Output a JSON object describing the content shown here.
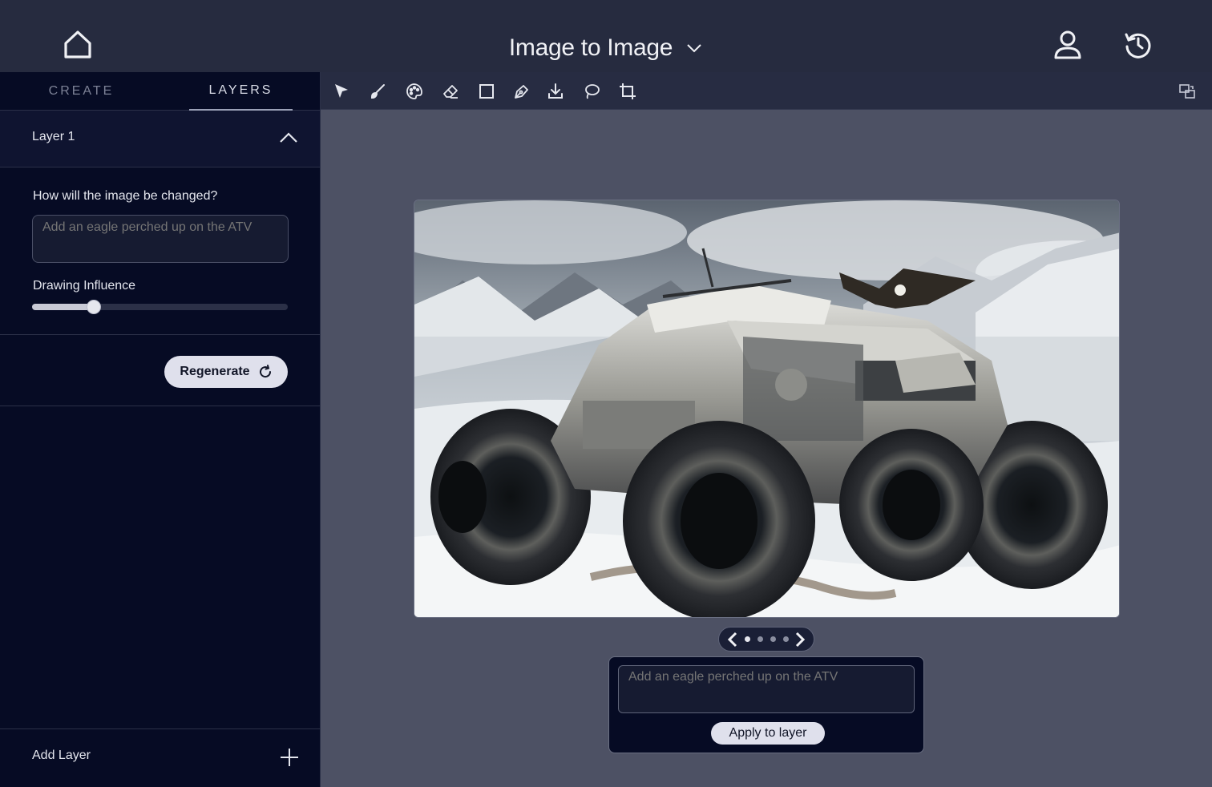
{
  "header": {
    "title": "Image to Image",
    "icons": {
      "home": "home-icon",
      "title_dropdown": "chevron-down-icon",
      "user": "user-icon",
      "history": "history-icon"
    }
  },
  "sidebar": {
    "tabs": [
      {
        "label": "CREATE",
        "active": false
      },
      {
        "label": "LAYERS",
        "active": true
      }
    ],
    "layer": {
      "name": "Layer 1",
      "expanded": true,
      "prompt_label": "How will the image be changed?",
      "prompt_placeholder": "Add an eagle perched up on the ATV",
      "influence_label": "Drawing Influence",
      "influence_value": 0.24,
      "regenerate_label": "Regenerate"
    },
    "add_layer_label": "Add Layer"
  },
  "toolbar": {
    "tools": [
      "select-tool-icon",
      "brush-tool-icon",
      "palette-tool-icon",
      "eraser-tool-icon",
      "rectangle-tool-icon",
      "pen-tool-icon",
      "download-tool-icon",
      "lasso-tool-icon",
      "crop-tool-icon"
    ],
    "right_tool": "compare-tool-icon"
  },
  "canvas": {
    "image_description_icon": "generated-image",
    "pager": {
      "count": 4,
      "active": 0
    }
  },
  "apply": {
    "placeholder": "Add an eagle perched up on the ATV",
    "button_label": "Apply to layer"
  },
  "colors": {
    "topbar": "#262b3f",
    "sidebar": "#060b24",
    "workspace": "#4d5164",
    "button_bg": "#dfe0ec"
  }
}
